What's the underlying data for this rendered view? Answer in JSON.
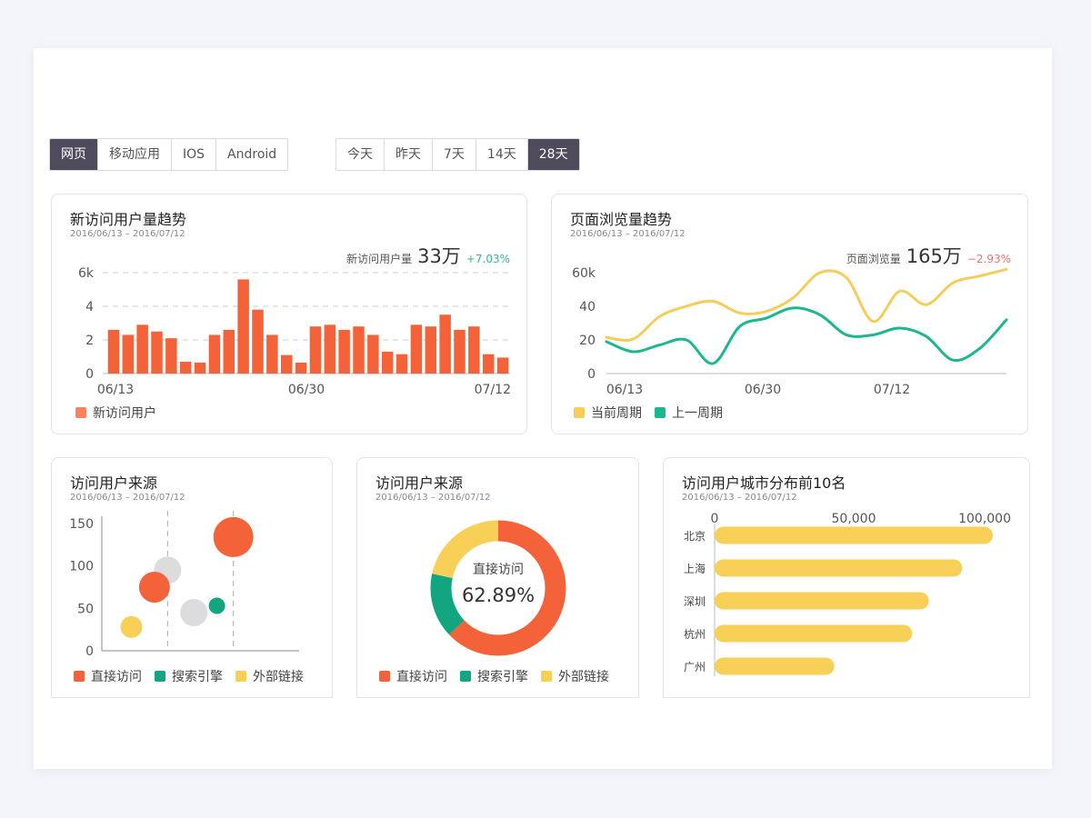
{
  "platform_tabs": [
    {
      "label": "网页",
      "active": true
    },
    {
      "label": "移动应用",
      "active": false
    },
    {
      "label": "IOS",
      "active": false
    },
    {
      "label": "Android",
      "active": false
    }
  ],
  "range_tabs": [
    {
      "label": "今天",
      "active": false
    },
    {
      "label": "昨天",
      "active": false
    },
    {
      "label": "7天",
      "active": false
    },
    {
      "label": "14天",
      "active": false
    },
    {
      "label": "28天",
      "active": true
    }
  ],
  "colors": {
    "bar": "#f4623a",
    "current": "#f5cd5a",
    "previous": "#1bb88f",
    "direct": "#f4623a",
    "search": "#13a580",
    "external": "#f8cf57",
    "gray": "#dcdcdf",
    "up": "#2cba8f",
    "down": "#f27272"
  },
  "new_users": {
    "title": "新访问用户量趋势",
    "date_range": "2016/06/13 – 2016/07/12",
    "kpi_label": "新访问用户量",
    "kpi_value": "33万",
    "kpi_change": "+7.03%",
    "legend": "新访问用户"
  },
  "page_views": {
    "title": "页面浏览量趋势",
    "date_range": "2016/06/13 – 2016/07/12",
    "kpi_label": "页面浏览量",
    "kpi_value": "165万",
    "kpi_change": "−2.93%",
    "legend_current": "当前周期",
    "legend_previous": "上一周期"
  },
  "source_scatter": {
    "title": "访问用户来源",
    "date_range": "2016/06/13 – 2016/07/12",
    "legend": [
      "直接访问",
      "搜索引擎",
      "外部链接"
    ]
  },
  "source_donut": {
    "title": "访问用户来源",
    "date_range": "2016/06/13 – 2016/07/12",
    "center_label": "直接访问",
    "center_value": "62.89%",
    "legend": [
      "直接访问",
      "搜索引擎",
      "外部链接"
    ]
  },
  "city": {
    "title": "访问用户城市分布前10名",
    "date_range": "2016/06/13 – 2016/07/12"
  },
  "chart_data": [
    {
      "type": "bar",
      "title": "新访问用户量趋势",
      "x_tick_labels": [
        "06/13",
        "06/30",
        "07/12"
      ],
      "y_tick_labels": [
        "0",
        "2",
        "4",
        "6k"
      ],
      "ylim": [
        0,
        6000
      ],
      "values": [
        2600,
        2300,
        2900,
        2500,
        2100,
        700,
        650,
        2300,
        2600,
        5600,
        3800,
        2300,
        1100,
        650,
        2800,
        2900,
        2600,
        2800,
        2300,
        1300,
        1150,
        2900,
        2800,
        3500,
        2600,
        2800,
        1150,
        950
      ],
      "series_name": "新访问用户",
      "grid": true
    },
    {
      "type": "line",
      "title": "页面浏览量趋势",
      "x_tick_labels": [
        "06/13",
        "06/30",
        "07/12"
      ],
      "y_tick_labels": [
        "0",
        "20",
        "40",
        "60k"
      ],
      "ylim": [
        0,
        60000
      ],
      "series": [
        {
          "name": "当前周期",
          "values": [
            21500,
            20500,
            34000,
            40000,
            43000,
            36000,
            37000,
            45000,
            60000,
            57000,
            31000,
            49000,
            41000,
            54000,
            58000,
            62000
          ]
        },
        {
          "name": "上一周期",
          "values": [
            19000,
            13000,
            17000,
            20000,
            6000,
            28000,
            33000,
            39000,
            35000,
            23000,
            23000,
            27000,
            22000,
            8000,
            15000,
            32000
          ]
        }
      ]
    },
    {
      "type": "scatter",
      "title": "访问用户来源",
      "y_tick_labels": [
        "0",
        "50",
        "100",
        "150"
      ],
      "ylim": [
        0,
        150
      ],
      "points": [
        {
          "group": "直接访问",
          "x": 4.0,
          "y": 134,
          "size": 22
        },
        {
          "group": "直接访问",
          "x": 1.6,
          "y": 75,
          "size": 17
        },
        {
          "group": "搜索引擎",
          "x": 3.5,
          "y": 53,
          "size": 9
        },
        {
          "group": "外部链接",
          "x": 0.9,
          "y": 28,
          "size": 12
        },
        {
          "group": "gray",
          "x": 2.0,
          "y": 95,
          "size": 15
        },
        {
          "group": "gray",
          "x": 2.8,
          "y": 45,
          "size": 15
        }
      ],
      "guides_x": [
        2.0,
        4.0
      ],
      "xlim": [
        0,
        6
      ]
    },
    {
      "type": "pie",
      "title": "访问用户来源",
      "slices": [
        {
          "name": "直接访问",
          "value": 62.89
        },
        {
          "name": "搜索引擎",
          "value": 15.5
        },
        {
          "name": "外部链接",
          "value": 21.61
        }
      ]
    },
    {
      "type": "bar",
      "orientation": "horizontal",
      "title": "访问用户城市分布前10名",
      "categories": [
        "北京",
        "上海",
        "深圳",
        "杭州",
        "广州"
      ],
      "values": [
        100000,
        89000,
        77000,
        71000,
        43000
      ],
      "x_tick_labels": [
        "0",
        "50,000",
        "100,000"
      ],
      "xlim": [
        0,
        100000
      ]
    }
  ]
}
